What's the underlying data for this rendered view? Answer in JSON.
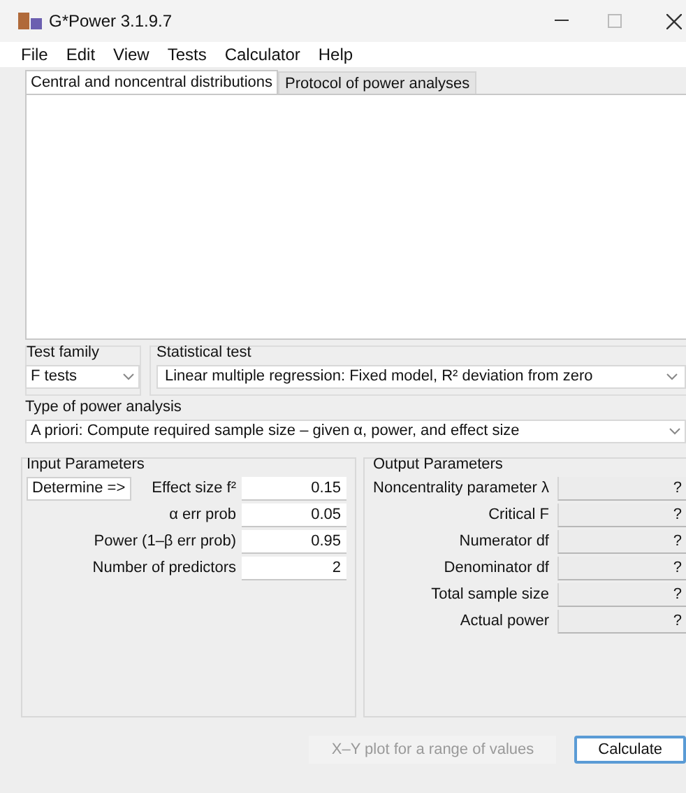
{
  "window": {
    "title": "G*Power 3.1.9.7"
  },
  "menu": [
    "File",
    "Edit",
    "View",
    "Tests",
    "Calculator",
    "Help"
  ],
  "tabs": [
    {
      "label": "Central and noncentral distributions",
      "selected": true
    },
    {
      "label": "Protocol of power analyses",
      "selected": false
    }
  ],
  "test_family": {
    "label": "Test family",
    "value": "F tests"
  },
  "statistical_test": {
    "label": "Statistical test",
    "value": "Linear multiple regression: Fixed model, R² deviation from zero"
  },
  "analysis_type": {
    "label": "Type of power analysis",
    "value": "A priori: Compute required sample size – given α, power, and effect size"
  },
  "input_parameters": {
    "title": "Input Parameters",
    "determine_button": "Determine =>",
    "rows": [
      {
        "label": "Effect size f²",
        "value": "0.15"
      },
      {
        "label": "α err prob",
        "value": "0.05"
      },
      {
        "label": "Power (1–β err prob)",
        "value": "0.95"
      },
      {
        "label": "Number of predictors",
        "value": "2"
      }
    ]
  },
  "output_parameters": {
    "title": "Output Parameters",
    "rows": [
      {
        "label": "Noncentrality parameter λ",
        "value": "?"
      },
      {
        "label": "Critical F",
        "value": "?"
      },
      {
        "label": "Numerator df",
        "value": "?"
      },
      {
        "label": "Denominator df",
        "value": "?"
      },
      {
        "label": "Total sample size",
        "value": "?"
      },
      {
        "label": "Actual power",
        "value": "?"
      }
    ]
  },
  "buttons": [
    {
      "label": "X–Y plot for a range of values",
      "disabled": true,
      "focused": false
    },
    {
      "label": "Calculate",
      "disabled": false,
      "focused": true
    }
  ]
}
